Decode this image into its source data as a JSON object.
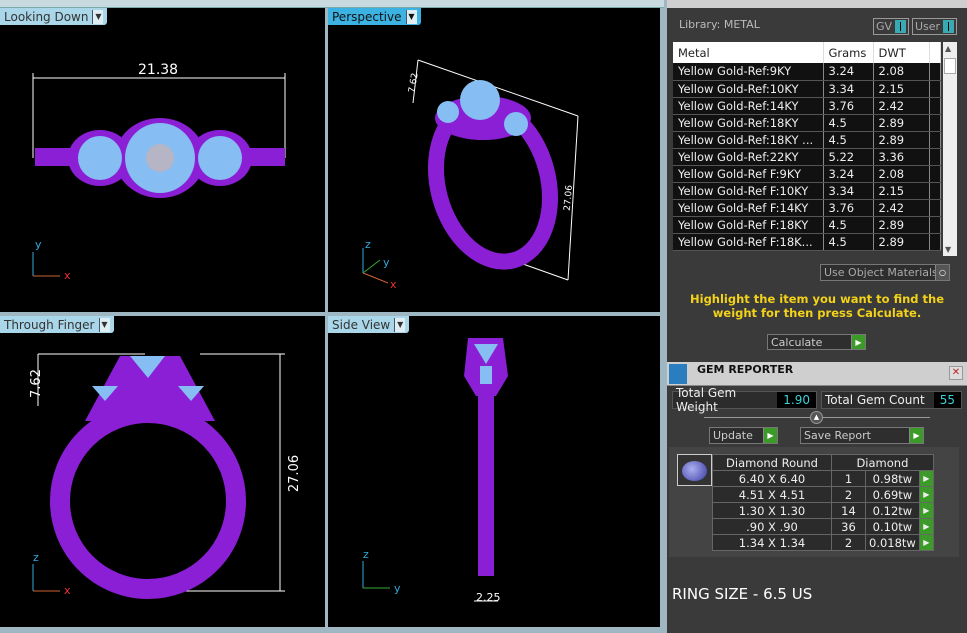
{
  "viewports": [
    {
      "label": "Looking Down",
      "dims": [
        "21.38"
      ]
    },
    {
      "label": "Perspective",
      "dims": [
        "7.62",
        "27.06"
      ]
    },
    {
      "label": "Through Finger",
      "dims": [
        "7.62",
        "27.06"
      ]
    },
    {
      "label": "Side View",
      "dims": [
        "2.25"
      ]
    }
  ],
  "axes": {
    "x": "x",
    "y": "y",
    "z": "z"
  },
  "metal": {
    "library": "Library: METAL",
    "toggles": [
      "GV",
      "User"
    ],
    "columns": [
      "Metal",
      "Grams",
      "DWT"
    ],
    "rows": [
      [
        "Yellow Gold-Ref:9KY",
        "3.24",
        "2.08"
      ],
      [
        "Yellow Gold-Ref:10KY",
        "3.34",
        "2.15"
      ],
      [
        "Yellow Gold-Ref:14KY",
        "3.76",
        "2.42"
      ],
      [
        "Yellow Gold-Ref:18KY",
        "4.5",
        "2.89"
      ],
      [
        "Yellow Gold-Ref:18KY ...",
        "4.5",
        "2.89"
      ],
      [
        "Yellow Gold-Ref:22KY",
        "5.22",
        "3.36"
      ],
      [
        "Yellow Gold-Ref F:9KY",
        "3.24",
        "2.08"
      ],
      [
        "Yellow Gold-Ref F:10KY",
        "3.34",
        "2.15"
      ],
      [
        "Yellow Gold-Ref F:14KY",
        "3.76",
        "2.42"
      ],
      [
        "Yellow Gold-Ref F:18KY",
        "4.5",
        "2.89"
      ],
      [
        "Yellow Gold-Ref F:18K...",
        "4.5",
        "2.89"
      ]
    ],
    "use_object_materials": "Use Object Materials",
    "hint": "Highlight the item you want to find the weight for then press Calculate.",
    "calculate": "Calculate"
  },
  "gem": {
    "title": "GEM REPORTER",
    "total_weight_label": "Total Gem Weight",
    "total_weight": "1.90",
    "total_count_label": "Total Gem Count",
    "total_count": "55",
    "update": "Update",
    "save_report": "Save Report",
    "shape_header": "Diamond Round",
    "type_header": "Diamond",
    "rows": [
      [
        "6.40 X 6.40",
        "1",
        "0.98tw"
      ],
      [
        "4.51 X 4.51",
        "2",
        "0.69tw"
      ],
      [
        "1.30 X 1.30",
        "14",
        "0.12tw"
      ],
      [
        ".90 X .90",
        "36",
        "0.10tw"
      ],
      [
        "1.34 X 1.34",
        "2",
        "0.018tw"
      ]
    ]
  },
  "ring_size": "RING SIZE - 6.5 US",
  "colors": {
    "metal": "#8b1fd6",
    "gem": "#86bdf2",
    "active_tab": "#3cb2e2",
    "hint": "#f3d21a",
    "go": "#3c9a28"
  }
}
